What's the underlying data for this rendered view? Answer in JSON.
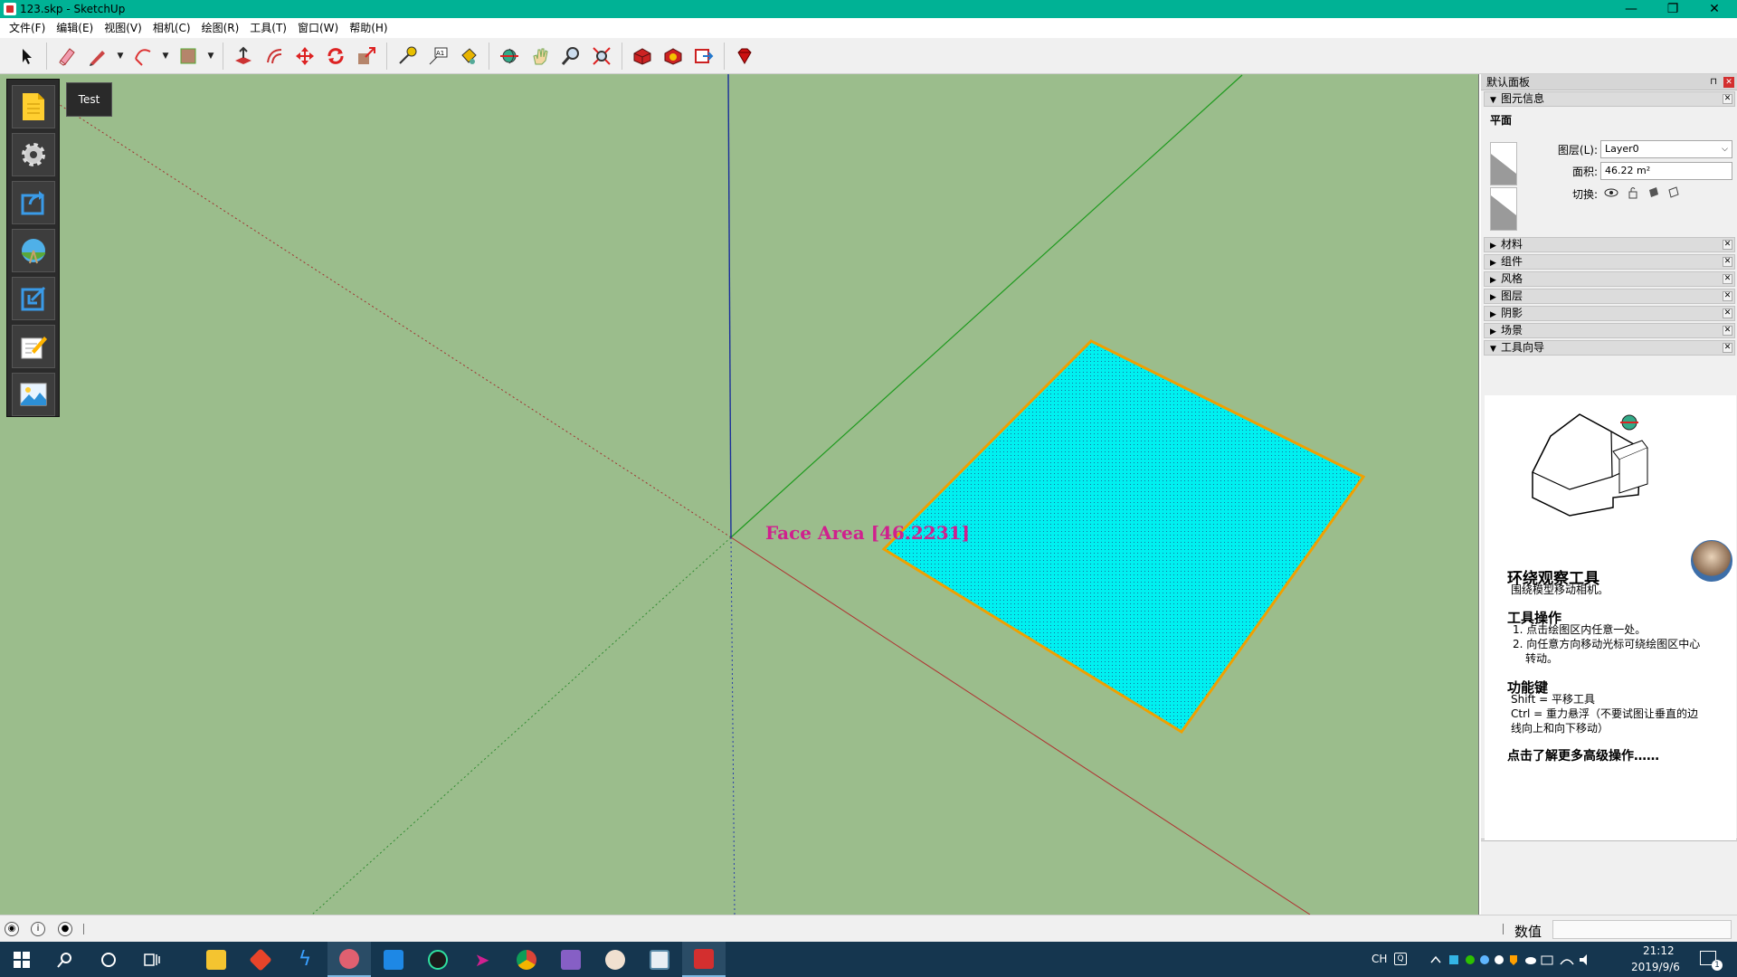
{
  "window": {
    "title": "123.skp - SketchUp",
    "minimize": "—",
    "restore": "❐",
    "close": "✕"
  },
  "menu": [
    "文件(F)",
    "编辑(E)",
    "视图(V)",
    "相机(C)",
    "绘图(R)",
    "工具(T)",
    "窗口(W)",
    "帮助(H)"
  ],
  "tooltip": "Test",
  "viewport": {
    "face_label": "Face Area [46.2231]",
    "background": "#9bbd8c",
    "face_color": "#00f0f0",
    "edge_color": "#f0a000"
  },
  "tray": {
    "title": "默认面板",
    "entity_info": {
      "header": "图元信息",
      "entity_type": "平面",
      "layer_label": "图层(L):",
      "layer_value": "Layer0",
      "area_label": "面积:",
      "area_value": "46.22 m²",
      "toggle_label": "切换:"
    },
    "panels": [
      "材料",
      "组件",
      "风格",
      "图层",
      "阴影",
      "场景"
    ],
    "instructor": {
      "header": "工具向导",
      "tool_title": "环绕观察工具",
      "tool_desc": "围绕模型移动相机。",
      "ops_title": "工具操作",
      "ops": [
        "1. 点击绘图区内任意一处。",
        "2. 向任意方向移动光标可绕绘图区中心",
        "转动。"
      ],
      "keys_title": "功能键",
      "keys": [
        "Shift = 平移工具",
        "Ctrl = 重力悬浮（不要试图让垂直的边",
        "线向上和向下移动）"
      ],
      "more": "点击了解更多高级操作……"
    }
  },
  "statusbar": {
    "vcb_label": "数值",
    "vcb_value": ""
  },
  "taskbar": {
    "ime": "CH",
    "time": "21:12",
    "date": "2019/9/6",
    "notification_count": "1"
  }
}
